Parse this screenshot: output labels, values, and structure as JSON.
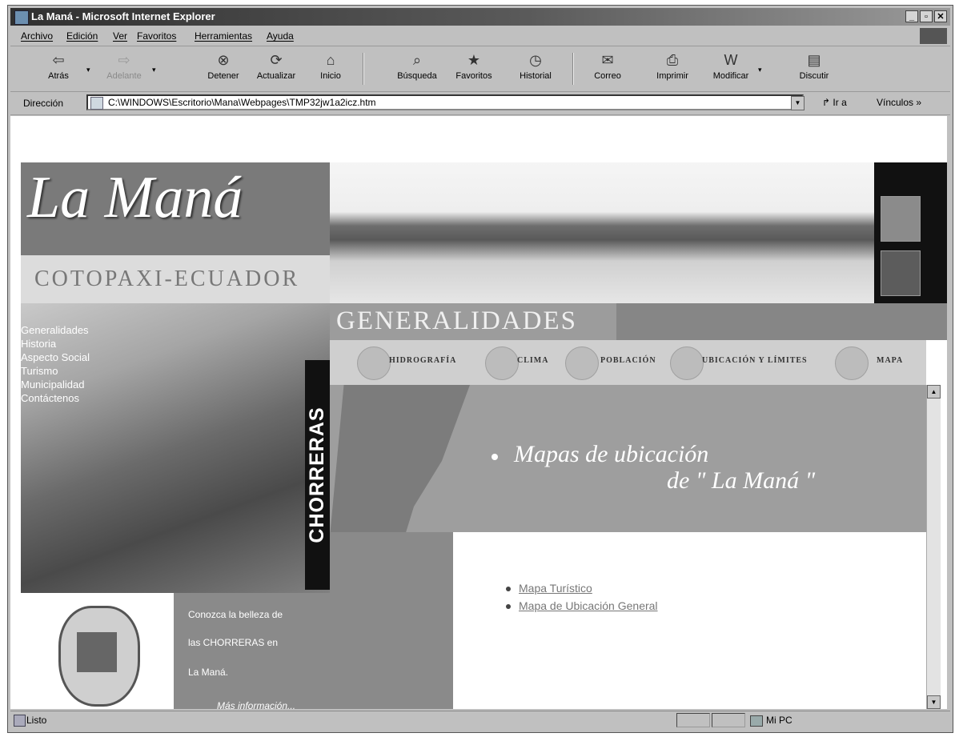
{
  "window": {
    "title": "La Maná - Microsoft Internet Explorer"
  },
  "menu": [
    "Archivo",
    "Edición",
    "Ver",
    "Favoritos",
    "Herramientas",
    "Ayuda"
  ],
  "toolbar": {
    "back": "Atrás",
    "forward": "Adelante",
    "stop": "Detener",
    "refresh": "Actualizar",
    "home": "Inicio",
    "search": "Búsqueda",
    "favorites": "Favoritos",
    "history": "Historial",
    "mail": "Correo",
    "print": "Imprimir",
    "edit": "Modificar",
    "discuss": "Discutir"
  },
  "address": {
    "label": "Dirección",
    "value": "C:\\WINDOWS\\Escritorio\\Mana\\Webpages\\TMP32jw1a2icz.htm",
    "go": "Ir a",
    "links": "Vínculos »"
  },
  "page": {
    "logo": "La Maná",
    "region": "COTOPAXI-ECUADOR",
    "nav": [
      "Generalidades",
      "Historia",
      "Aspecto Social",
      "Turismo",
      "Municipalidad",
      "Contáctenos"
    ],
    "vertical_label": "CHORRERAS",
    "section_title": "GENERALIDADES",
    "subnav": [
      "HIDROGRAFÍA",
      "CLIMA",
      "POBLACIÓN",
      "UBICACIÓN Y LÍMITES",
      "MAPA"
    ],
    "map_title_line1": "Mapas de ubicación",
    "map_title_line2": "de \" La Maná \"",
    "map_links": [
      "Mapa Turístico",
      "Mapa de Ubicación General"
    ],
    "promo_lines": [
      "Conozca la belleza de",
      "las CHORRERAS en",
      "La Maná."
    ],
    "promo_more": "Más información..."
  },
  "status": {
    "text": "Listo",
    "zone": "Mi PC"
  }
}
